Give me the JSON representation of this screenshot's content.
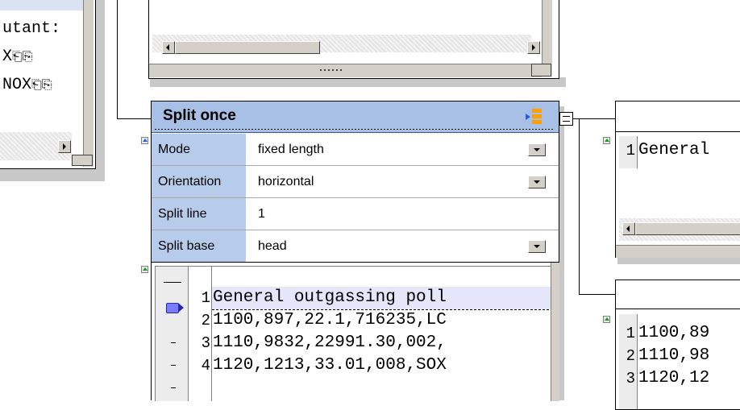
{
  "left_panel": {
    "lines": [
      "utant:",
      "X",
      "NOX"
    ]
  },
  "split_node": {
    "title": "Split once",
    "props": [
      {
        "label": "Mode",
        "value": "fixed length",
        "has_dropdown": true
      },
      {
        "label": "Orientation",
        "value": "horizontal",
        "has_dropdown": true
      },
      {
        "label": "Split line",
        "value": "1",
        "has_dropdown": false
      },
      {
        "label": "Split base",
        "value": "head",
        "has_dropdown": true
      }
    ],
    "preview": {
      "lines": [
        {
          "num": "1",
          "text": "General outgassing poll"
        },
        {
          "num": "2",
          "text": "1100,897,22.1,716235,LC"
        },
        {
          "num": "3",
          "text": "1110,9832,22991.30,002,"
        },
        {
          "num": "4",
          "text": "1120,1213,33.01,008,SOX"
        }
      ]
    }
  },
  "right_top": {
    "lines": [
      {
        "num": "1",
        "text": "General"
      }
    ]
  },
  "right_bottom": {
    "lines": [
      {
        "num": "1",
        "text": "1100,89"
      },
      {
        "num": "2",
        "text": "1110,98"
      },
      {
        "num": "3",
        "text": "1120,12"
      }
    ]
  },
  "colors": {
    "header_bg": "#a8bfe6",
    "label_bg": "#b7cbea",
    "accent": "#ffa000",
    "marker": "#7a7aff"
  }
}
